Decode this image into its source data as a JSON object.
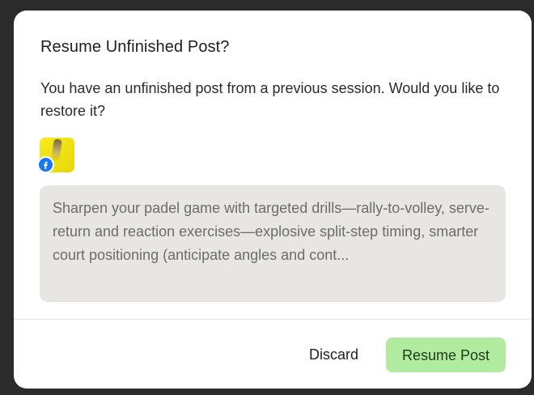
{
  "dialog": {
    "title": "Resume Unfinished Post?",
    "message": "You have an unfinished post from a previous session. Would you like to restore it?",
    "attachment": {
      "network_icon": "facebook-icon",
      "network_color": "#1877f2",
      "thumbnail_color": "#f1e30e"
    },
    "preview_text": "Sharpen your padel game with targeted drills—rally-to-volley, serve-return and reaction exercises—explosive split-step timing, smarter court positioning (anticipate angles and cont...",
    "buttons": {
      "discard": "Discard",
      "resume": "Resume Post"
    },
    "colors": {
      "resume_button": "#b1eba0",
      "preview_background": "#e8e6e3"
    }
  }
}
